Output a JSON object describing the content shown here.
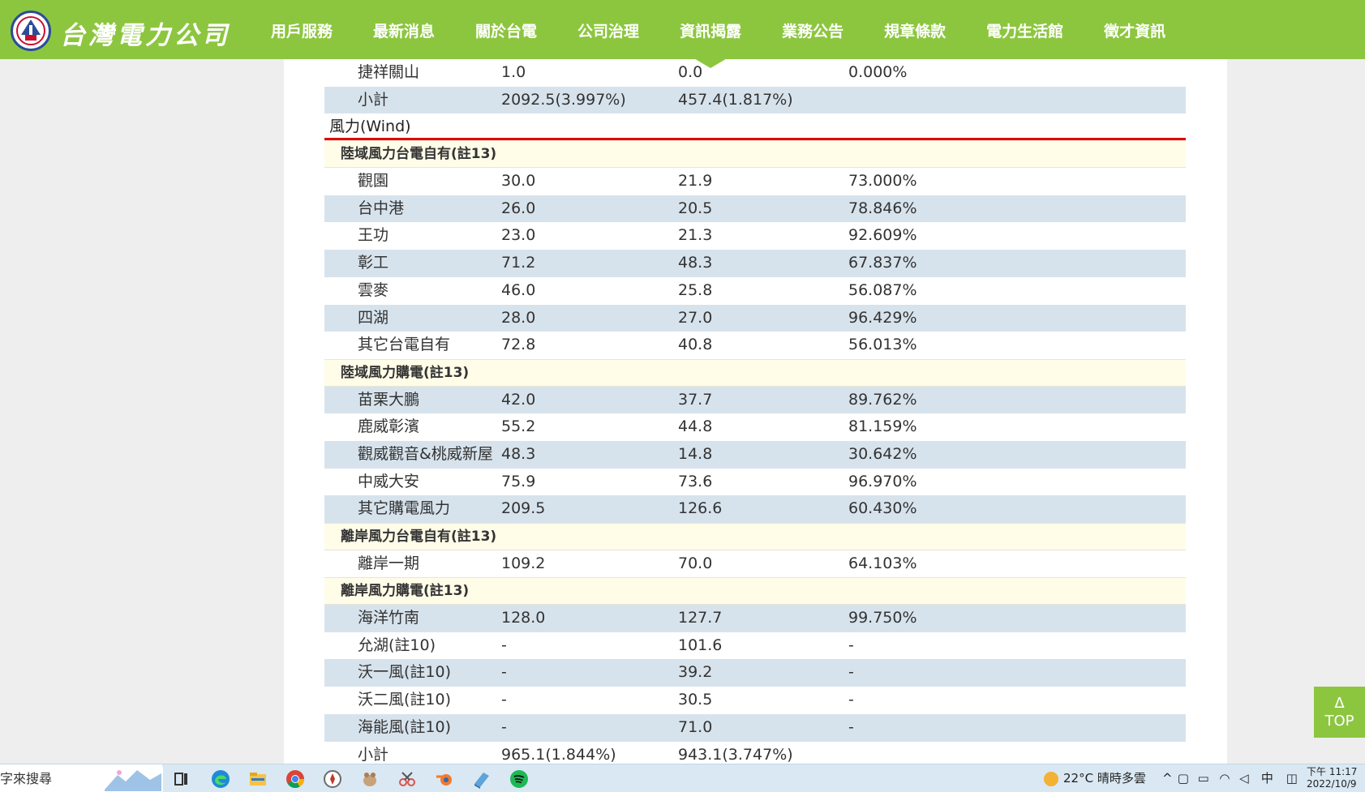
{
  "header": {
    "logo_text": "台灣電力公司",
    "nav": [
      "用戶服務",
      "最新消息",
      "關於台電",
      "公司治理",
      "資訊揭露",
      "業務公告",
      "規章條款",
      "電力生活館",
      "徵才資訊"
    ],
    "active_nav_index": 4,
    "brand_color": "#8cc63f"
  },
  "table": {
    "rows_before": [
      {
        "name": "捷祥關山",
        "capacity": "1.0",
        "generation": "0.0",
        "ratio": "0.000%",
        "alt": false
      },
      {
        "name": "小計",
        "capacity": "2092.5(3.997%)",
        "generation": "457.4(1.817%)",
        "ratio": "",
        "alt": true
      }
    ],
    "category_title": "風力(Wind)",
    "sections": [
      {
        "title": "陸域風力台電自有(註13)",
        "rows": [
          {
            "name": "觀園",
            "capacity": "30.0",
            "generation": "21.9",
            "ratio": "73.000%"
          },
          {
            "name": "台中港",
            "capacity": "26.0",
            "generation": "20.5",
            "ratio": "78.846%"
          },
          {
            "name": "王功",
            "capacity": "23.0",
            "generation": "21.3",
            "ratio": "92.609%"
          },
          {
            "name": "彰工",
            "capacity": "71.2",
            "generation": "48.3",
            "ratio": "67.837%"
          },
          {
            "name": "雲麥",
            "capacity": "46.0",
            "generation": "25.8",
            "ratio": "56.087%"
          },
          {
            "name": "四湖",
            "capacity": "28.0",
            "generation": "27.0",
            "ratio": "96.429%"
          },
          {
            "name": "其它台電自有",
            "capacity": "72.8",
            "generation": "40.8",
            "ratio": "56.013%"
          }
        ]
      },
      {
        "title": "陸域風力購電(註13)",
        "rows": [
          {
            "name": "苗栗大鵬",
            "capacity": "42.0",
            "generation": "37.7",
            "ratio": "89.762%"
          },
          {
            "name": "鹿威彰濱",
            "capacity": "55.2",
            "generation": "44.8",
            "ratio": "81.159%"
          },
          {
            "name": "觀威觀音&桃威新屋",
            "capacity": "48.3",
            "generation": "14.8",
            "ratio": "30.642%"
          },
          {
            "name": "中威大安",
            "capacity": "75.9",
            "generation": "73.6",
            "ratio": "96.970%"
          },
          {
            "name": "其它購電風力",
            "capacity": "209.5",
            "generation": "126.6",
            "ratio": "60.430%"
          }
        ]
      },
      {
        "title": "離岸風力台電自有(註13)",
        "rows": [
          {
            "name": "離岸一期",
            "capacity": "109.2",
            "generation": "70.0",
            "ratio": "64.103%"
          }
        ]
      },
      {
        "title": "離岸風力購電(註13)",
        "rows": [
          {
            "name": "海洋竹南",
            "capacity": "128.0",
            "generation": "127.7",
            "ratio": "99.750%"
          },
          {
            "name": "允湖(註10)",
            "capacity": "-",
            "generation": "101.6",
            "ratio": "-"
          },
          {
            "name": "沃一風(註10)",
            "capacity": "-",
            "generation": "39.2",
            "ratio": "-"
          },
          {
            "name": "沃二風(註10)",
            "capacity": "-",
            "generation": "30.5",
            "ratio": "-"
          },
          {
            "name": "海能風(註10)",
            "capacity": "-",
            "generation": "71.0",
            "ratio": "-"
          }
        ]
      }
    ],
    "subtotal": {
      "name": "小計",
      "capacity": "965.1(1.844%)",
      "generation": "943.1(3.747%)",
      "ratio": ""
    },
    "alt_row_color": "#d7e3ec",
    "section_row_color": "#fffce8",
    "divider_color": "#e00000"
  },
  "top_button": {
    "arrow": "Δ",
    "label": "TOP"
  },
  "taskbar": {
    "search_text": "字來搜尋",
    "weather": "22°C  晴時多雲",
    "ime": "中",
    "clock_time": "下午 11:17",
    "clock_date": "2022/10/9",
    "pinned_icons": [
      "task-view-icon",
      "edge-icon",
      "file-explorer-icon",
      "chrome-icon",
      "app-compass-icon",
      "app-animal-icon",
      "app-snip-icon",
      "blender-icon",
      "app-files-icon",
      "spotify-icon"
    ]
  }
}
